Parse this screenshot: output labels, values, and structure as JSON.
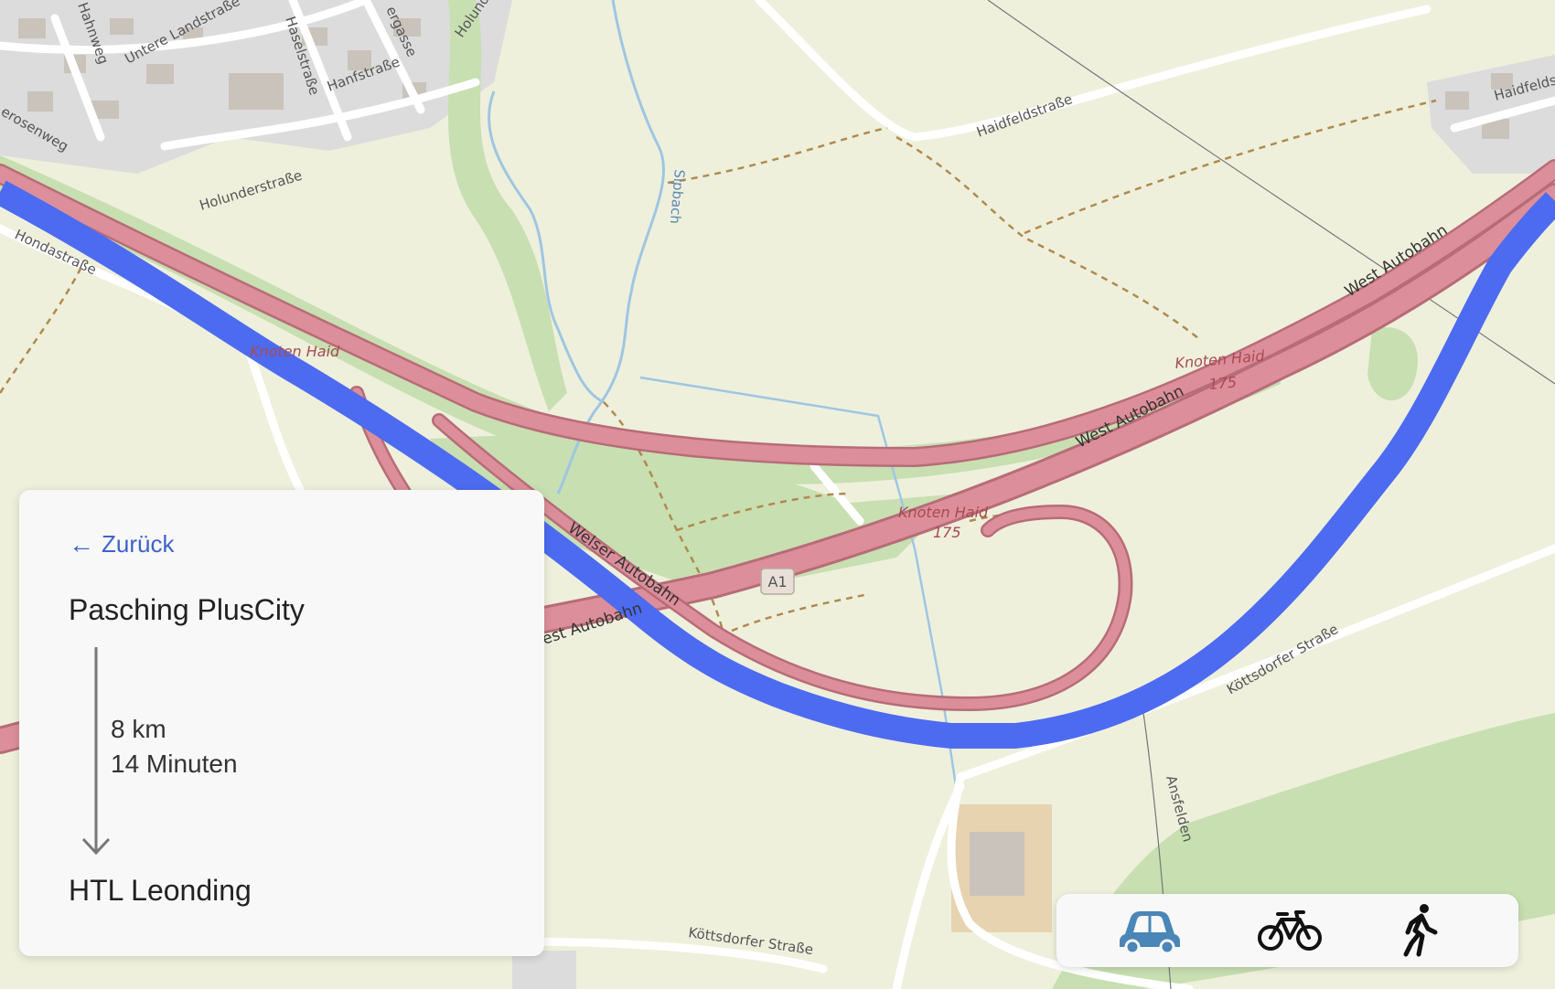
{
  "map": {
    "street_labels": {
      "untere_landstrasse": "Untere Landstraße",
      "hahnweg": "Hahnweg",
      "haselstrasse": "Haselstraße",
      "hanfstrasse": "Hanfstraße",
      "holundergasse": "Holunde",
      "holunderstrasse": "Holunderstraße",
      "erlengasse": "ergasse",
      "rosenweg": "erosenweg",
      "hondastrasse": "Hondastraße",
      "haidfeldstrasse": "Haidfeldstraße",
      "haidfeldstrasse_2": "Haidfelds",
      "sipbach": "Sipbach",
      "west_autobahn_1": "West Autobahn",
      "west_autobahn_2": "West Autobahn",
      "west_autobahn_3": "est Autobahn",
      "welser_autobahn": "Welser Autobahn",
      "knoten_haid_1": "Knoten Haid",
      "knoten_haid_1_num": "175",
      "knoten_haid_2": "Knoten Haid",
      "knoten_haid_2_num": "175",
      "knoten_haid_3": "Knoten Haid",
      "a1_shield": "A1",
      "koettsdorfer_strasse_1": "Köttsdorfer Straße",
      "koettsdorfer_strasse_2": "Köttsdorfer Straße",
      "ansfelden": "Ansfelden"
    },
    "colors": {
      "land": "#eef0dc",
      "green": "#c8dfb1",
      "motorway": "#dc8f9a",
      "route": "#4d6bf0",
      "water": "#9fc6e2",
      "residential": "#dcdcdc"
    }
  },
  "panel": {
    "back_label": "Zurück",
    "from": "Pasching PlusCity",
    "distance": "8 km",
    "duration": "14 Minuten",
    "to": "HTL Leonding"
  },
  "modes": {
    "items": [
      "car-icon",
      "bicycle-icon",
      "pedestrian-icon"
    ],
    "active": "car",
    "active_color": "#4a86b8",
    "inactive_color": "#111111"
  }
}
